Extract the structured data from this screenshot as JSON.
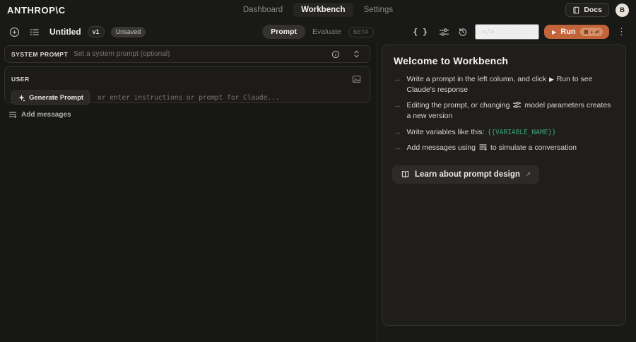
{
  "glyphs": {
    "braces": "{ }",
    "code_slash": "</>",
    "kebab": "⋮",
    "arrow": "→",
    "play": "▶",
    "external": "↗"
  },
  "topbar": {
    "logo": "ANTHROP\\C",
    "nav": [
      {
        "label": "Dashboard"
      },
      {
        "label": "Workbench"
      },
      {
        "label": "Settings"
      }
    ],
    "docs_label": "Docs",
    "avatar_initial": "B"
  },
  "toolbar": {
    "title": "Untitled",
    "version_badge": "v1",
    "status_badge": "Unsaved",
    "mode_prompt": "Prompt",
    "mode_evaluate": "Evaluate",
    "beta_badge": "BETA",
    "get_code_label": "Get Code",
    "run_label": "Run",
    "run_shortcut": "⌘ + ⏎"
  },
  "editor": {
    "system_prompt": {
      "label": "SYSTEM PROMPT",
      "placeholder": "Set a system prompt (optional)"
    },
    "user": {
      "label": "USER",
      "generate_label": "Generate Prompt",
      "placeholder": "or enter instructions or prompt for Claude..."
    },
    "add_messages_label": "Add messages"
  },
  "welcome": {
    "title": "Welcome to Workbench",
    "bullets": [
      {
        "pre": "Write a prompt in the left column, and click",
        "post": "Run to see Claude's response"
      },
      {
        "pre": "Editing the prompt, or changing",
        "post": "model parameters creates a new version"
      },
      {
        "pre": "Write variables like this:",
        "code": "{{VARIABLE_NAME}}"
      },
      {
        "pre": "Add messages using",
        "post": "to simulate a conversation"
      }
    ],
    "learn_label": "Learn about prompt design"
  },
  "colors": {
    "accent_orange": "#c2643a",
    "variable_green": "#3fa273",
    "page_background": "#191918"
  }
}
